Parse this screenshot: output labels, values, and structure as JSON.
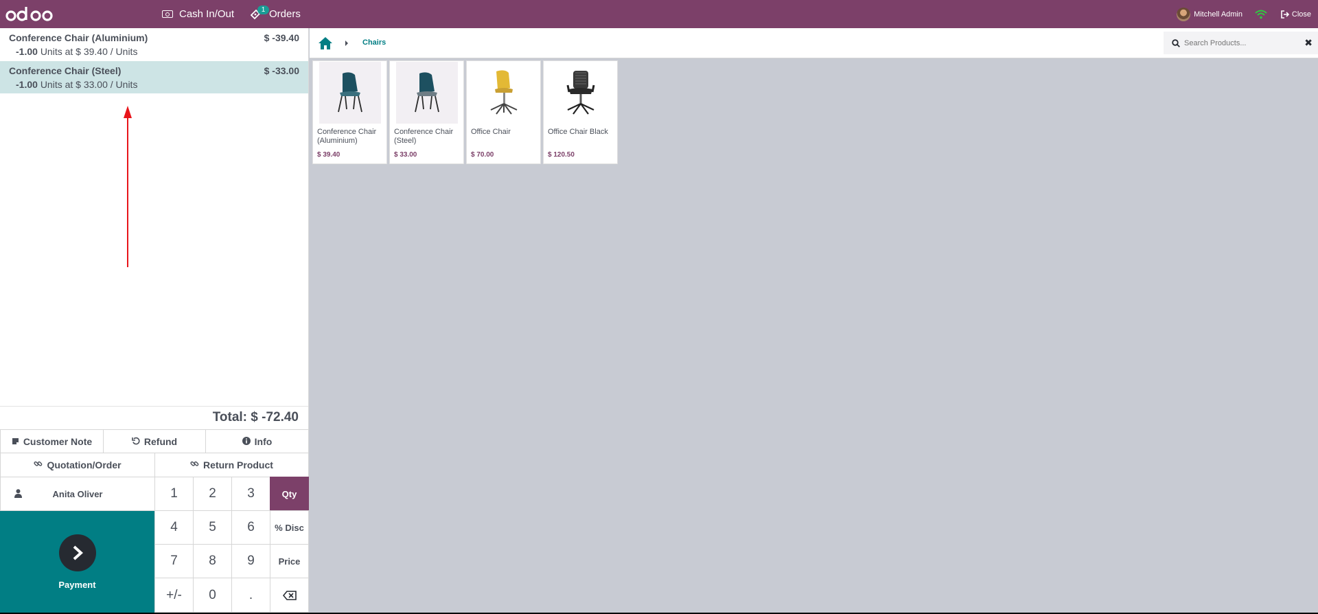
{
  "topbar": {
    "logo": "odoo",
    "cash_in_out": "Cash In/Out",
    "orders": "Orders",
    "orders_badge": "1",
    "user_name": "Mitchell Admin",
    "close": "Close"
  },
  "order": {
    "lines": [
      {
        "name": "Conference Chair (Aluminium)",
        "price": "$ -39.40",
        "qty": "-1.00",
        "detail": "Units at $ 39.40 / Units"
      },
      {
        "name": "Conference Chair (Steel)",
        "price": "$ -33.00",
        "qty": "-1.00",
        "detail": "Units at $ 33.00 / Units"
      }
    ],
    "total": "Total: $ -72.40"
  },
  "actions": {
    "customer_note": "Customer Note",
    "refund": "Refund",
    "info": "Info",
    "quotation_order": "Quotation/Order",
    "return_product": "Return Product"
  },
  "numpad": {
    "customer": "Anita Oliver",
    "keys": [
      "1",
      "2",
      "3",
      "4",
      "5",
      "6",
      "7",
      "8",
      "9",
      "+/-",
      "0",
      "."
    ],
    "modes": [
      "Qty",
      "% Disc",
      "Price"
    ],
    "active_mode": "Qty",
    "payment": "Payment"
  },
  "products_pane": {
    "breadcrumb": "Chairs",
    "search_placeholder": "Search Products...",
    "products": [
      {
        "name": "Conference Chair (Aluminium)",
        "price": "$ 39.40",
        "icon": "teal-chair"
      },
      {
        "name": "Conference Chair (Steel)",
        "price": "$ 33.00",
        "icon": "teal-chair"
      },
      {
        "name": "Office Chair",
        "price": "$ 70.00",
        "icon": "yellow-swivel-chair"
      },
      {
        "name": "Office Chair Black",
        "price": "$ 120.50",
        "icon": "black-office-chair"
      }
    ]
  },
  "colors": {
    "brand": "#7c4069",
    "accent": "#017e84",
    "selected_line": "#cde4e5",
    "annotation_arrow": "#e8141a"
  }
}
